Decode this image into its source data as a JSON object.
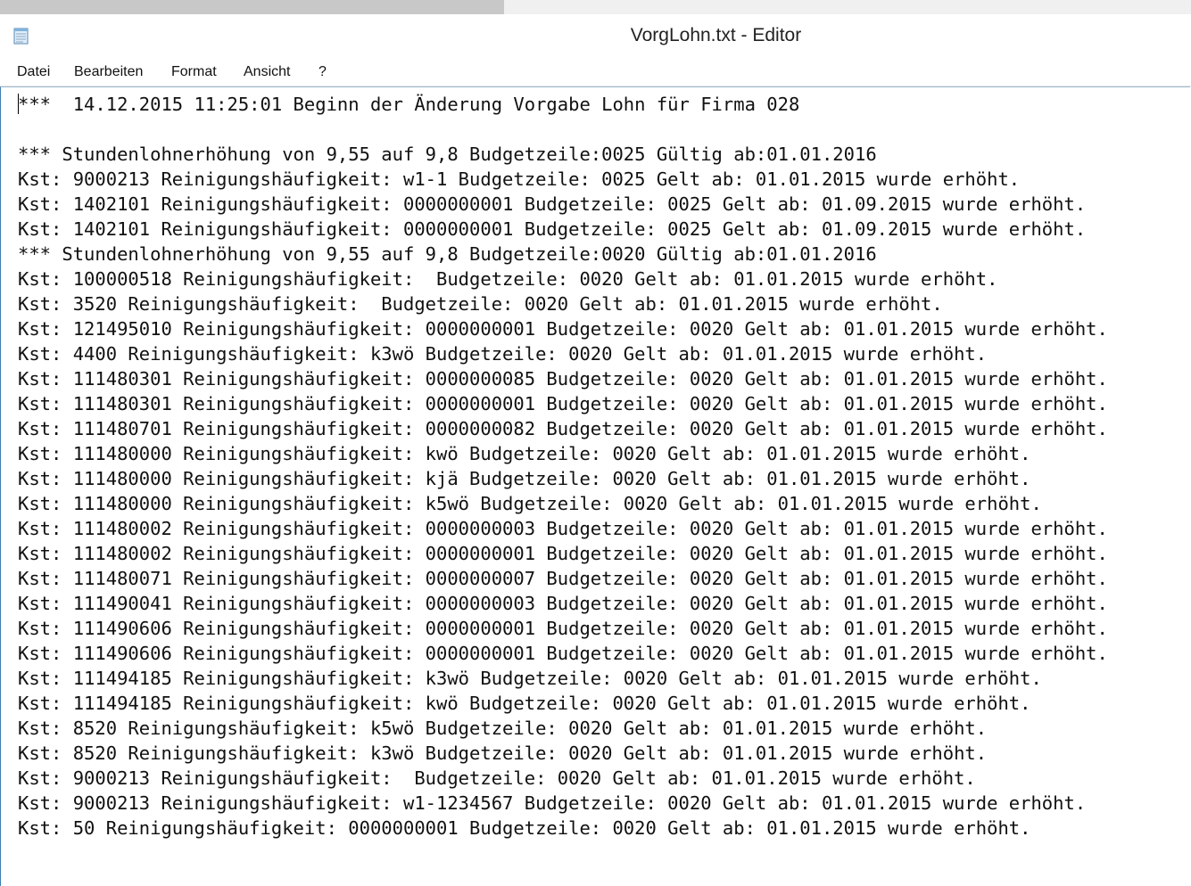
{
  "window": {
    "title": "VorgLohn.txt - Editor",
    "app_icon": "notepad-icon"
  },
  "menu": {
    "items": [
      "Datei",
      "Bearbeiten",
      "Format",
      "Ansicht",
      "?"
    ]
  },
  "editor": {
    "lines": [
      "***  14.12.2015 11:25:01 Beginn der Änderung Vorgabe Lohn für Firma 028",
      "",
      "*** Stundenlohnerhöhung von 9,55 auf 9,8 Budgetzeile:0025 Gültig ab:01.01.2016",
      "Kst: 9000213 Reinigungshäufigkeit: w1-1 Budgetzeile: 0025 Gelt ab: 01.01.2015 wurde erhöht.",
      "Kst: 1402101 Reinigungshäufigkeit: 0000000001 Budgetzeile: 0025 Gelt ab: 01.09.2015 wurde erhöht.",
      "Kst: 1402101 Reinigungshäufigkeit: 0000000001 Budgetzeile: 0025 Gelt ab: 01.09.2015 wurde erhöht.",
      "*** Stundenlohnerhöhung von 9,55 auf 9,8 Budgetzeile:0020 Gültig ab:01.01.2016",
      "Kst: 100000518 Reinigungshäufigkeit:  Budgetzeile: 0020 Gelt ab: 01.01.2015 wurde erhöht.",
      "Kst: 3520 Reinigungshäufigkeit:  Budgetzeile: 0020 Gelt ab: 01.01.2015 wurde erhöht.",
      "Kst: 121495010 Reinigungshäufigkeit: 0000000001 Budgetzeile: 0020 Gelt ab: 01.01.2015 wurde erhöht.",
      "Kst: 4400 Reinigungshäufigkeit: k3wö Budgetzeile: 0020 Gelt ab: 01.01.2015 wurde erhöht.",
      "Kst: 111480301 Reinigungshäufigkeit: 0000000085 Budgetzeile: 0020 Gelt ab: 01.01.2015 wurde erhöht.",
      "Kst: 111480301 Reinigungshäufigkeit: 0000000001 Budgetzeile: 0020 Gelt ab: 01.01.2015 wurde erhöht.",
      "Kst: 111480701 Reinigungshäufigkeit: 0000000082 Budgetzeile: 0020 Gelt ab: 01.01.2015 wurde erhöht.",
      "Kst: 111480000 Reinigungshäufigkeit: kwö Budgetzeile: 0020 Gelt ab: 01.01.2015 wurde erhöht.",
      "Kst: 111480000 Reinigungshäufigkeit: kjä Budgetzeile: 0020 Gelt ab: 01.01.2015 wurde erhöht.",
      "Kst: 111480000 Reinigungshäufigkeit: k5wö Budgetzeile: 0020 Gelt ab: 01.01.2015 wurde erhöht.",
      "Kst: 111480002 Reinigungshäufigkeit: 0000000003 Budgetzeile: 0020 Gelt ab: 01.01.2015 wurde erhöht.",
      "Kst: 111480002 Reinigungshäufigkeit: 0000000001 Budgetzeile: 0020 Gelt ab: 01.01.2015 wurde erhöht.",
      "Kst: 111480071 Reinigungshäufigkeit: 0000000007 Budgetzeile: 0020 Gelt ab: 01.01.2015 wurde erhöht.",
      "Kst: 111490041 Reinigungshäufigkeit: 0000000003 Budgetzeile: 0020 Gelt ab: 01.01.2015 wurde erhöht.",
      "Kst: 111490606 Reinigungshäufigkeit: 0000000001 Budgetzeile: 0020 Gelt ab: 01.01.2015 wurde erhöht.",
      "Kst: 111490606 Reinigungshäufigkeit: 0000000001 Budgetzeile: 0020 Gelt ab: 01.01.2015 wurde erhöht.",
      "Kst: 111494185 Reinigungshäufigkeit: k3wö Budgetzeile: 0020 Gelt ab: 01.01.2015 wurde erhöht.",
      "Kst: 111494185 Reinigungshäufigkeit: kwö Budgetzeile: 0020 Gelt ab: 01.01.2015 wurde erhöht.",
      "Kst: 8520 Reinigungshäufigkeit: k5wö Budgetzeile: 0020 Gelt ab: 01.01.2015 wurde erhöht.",
      "Kst: 8520 Reinigungshäufigkeit: k3wö Budgetzeile: 0020 Gelt ab: 01.01.2015 wurde erhöht.",
      "Kst: 9000213 Reinigungshäufigkeit:  Budgetzeile: 0020 Gelt ab: 01.01.2015 wurde erhöht.",
      "Kst: 9000213 Reinigungshäufigkeit: w1-1234567 Budgetzeile: 0020 Gelt ab: 01.01.2015 wurde erhöht.",
      "Kst: 50 Reinigungshäufigkeit: 0000000001 Budgetzeile: 0020 Gelt ab: 01.01.2015 wurde erhöht."
    ]
  }
}
